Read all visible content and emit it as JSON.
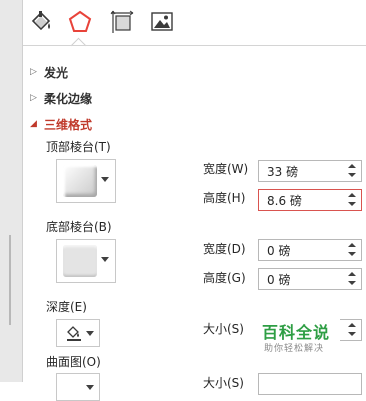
{
  "tabs": [
    {
      "name": "fill-line",
      "icon": "paint-bucket-icon"
    },
    {
      "name": "effects",
      "icon": "pentagon-icon",
      "active": true
    },
    {
      "name": "size-properties",
      "icon": "size-properties-icon"
    },
    {
      "name": "picture",
      "icon": "picture-icon"
    }
  ],
  "sections": {
    "glow": "发光",
    "soft_edges": "柔化边缘",
    "format_3d": "三维格式"
  },
  "format_3d": {
    "top_bevel_label": "顶部棱台(T)",
    "bottom_bevel_label": "底部棱台(B)",
    "depth_label": "深度(E)",
    "contour_label": "曲面图(O)",
    "top_width_label": "宽度(W)",
    "top_width_value": "33 磅",
    "top_height_label": "高度(H)",
    "top_height_value": "8.6 磅",
    "bottom_width_label": "宽度(D)",
    "bottom_width_value": "0 磅",
    "bottom_height_label": "高度(G)",
    "bottom_height_value": "0 磅",
    "depth_size_label": "大小(S)",
    "contour_size_label": "大小(S)"
  },
  "watermark": {
    "logo": "百科全说",
    "sub": "助你轻松解决"
  },
  "colors": {
    "accent": "#c0392b",
    "active_tab": "#e8433a",
    "watermark_green": "#2e9e44"
  }
}
